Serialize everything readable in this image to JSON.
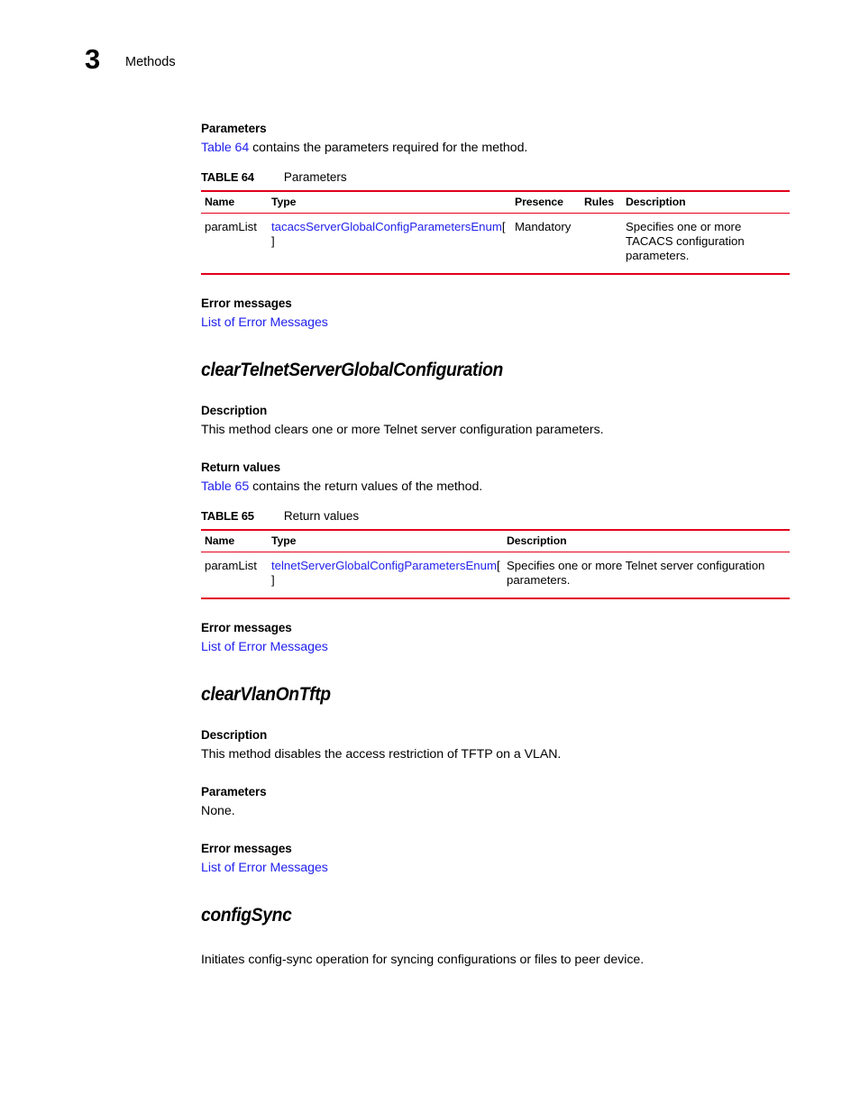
{
  "header": {
    "chapter_number": "3",
    "chapter_title": "Methods"
  },
  "colors": {
    "rule_red": "#e2001a",
    "link_blue": "#2222ee",
    "text_black": "#000000"
  },
  "sections": {
    "parameters_heading": "Parameters",
    "parameters_intro_link": "Table 64",
    "parameters_intro_rest": " contains the parameters required for the method.",
    "error_messages_heading_1": "Error messages",
    "error_messages_link_1": "List of Error Messages",
    "method_1_title": "clearTelnetServerGlobalConfiguration",
    "method_1_description_heading": "Description",
    "method_1_description_text": "This method clears one or more Telnet server configuration parameters.",
    "method_1_return_heading": "Return values",
    "method_1_return_intro_link": "Table 65",
    "method_1_return_intro_rest": " contains the return values of the method.",
    "error_messages_heading_2": "Error messages",
    "error_messages_link_2": "List of Error Messages",
    "method_2_title": "clearVlanOnTftp",
    "method_2_description_heading": "Description",
    "method_2_description_text": "This method disables the access restriction of TFTP on a VLAN.",
    "method_2_parameters_heading": "Parameters",
    "method_2_parameters_text": "None.",
    "error_messages_heading_3": "Error messages",
    "error_messages_link_3": "List of Error Messages",
    "method_3_title": "configSync",
    "method_3_description_text": "Initiates config-sync operation for syncing configurations or files to peer device."
  },
  "table_64": {
    "label": "TABLE 64",
    "title": "Parameters",
    "columns": [
      "Name",
      "Type",
      "Presence",
      "Rules",
      "Description"
    ],
    "rows": [
      {
        "name": "paramList",
        "type_link": "tacacsServerGlobalConfigParametersEnum",
        "type_suffix": "[ ]",
        "presence": "Mandatory",
        "rules": "",
        "description": "Specifies one or more TACACS configuration parameters."
      }
    ]
  },
  "table_65": {
    "label": "TABLE 65",
    "title": "Return values",
    "columns": [
      "Name",
      "Type",
      "Description"
    ],
    "rows": [
      {
        "name": "paramList",
        "type_link": "telnetServerGlobalConfigParametersEnum",
        "type_suffix": "[ ]",
        "description": "Specifies one or more Telnet server configuration parameters."
      }
    ]
  }
}
